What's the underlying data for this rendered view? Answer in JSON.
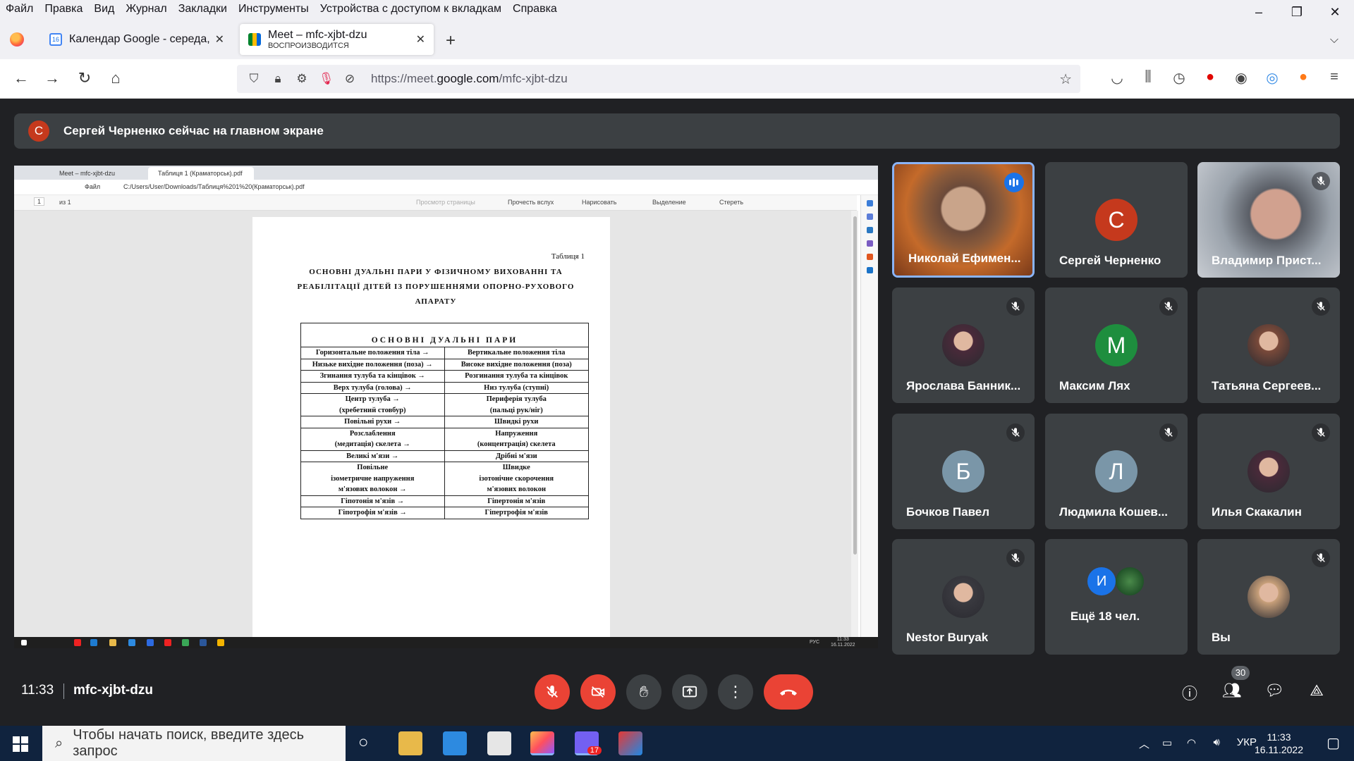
{
  "menubar": {
    "items": [
      "Файл",
      "Правка",
      "Вид",
      "Журнал",
      "Закладки",
      "Инструменты",
      "Устройства с доступом к вкладкам",
      "Справка"
    ]
  },
  "window_controls": {
    "minimize": "–",
    "restore": "❐",
    "close": "✕"
  },
  "tabs": [
    {
      "title": "Календар Google - середа, 16",
      "subtitle": "",
      "icon": "google-calendar-icon"
    },
    {
      "title": "Meet – mfc-xjbt-dzu",
      "subtitle": "ВОСПРОИЗВОДИТСЯ",
      "icon": "google-meet-icon"
    }
  ],
  "urlbar": {
    "url_prefix": "https://meet.",
    "url_domain": "google.com",
    "url_path": "/mfc-xjbt-dzu"
  },
  "banner": {
    "avatar_letter": "С",
    "text": "Сергей Черненко сейчас на главном экране"
  },
  "shared_screen": {
    "browser_tabs": [
      "Meet – mfc-xjbt-dzu",
      "Таблиця 1 (Краматорськ).pdf"
    ],
    "address": "C:/Users/User/Downloads/Таблиця%201%20(Краматорськ).pdf",
    "file_label": "Файл",
    "page_field": "1",
    "page_total": "из 1",
    "toolbar": [
      "Просмотр страницы",
      "Прочесть вслух",
      "Нарисовать",
      "Выделение",
      "Стереть"
    ],
    "document": {
      "table_number": "Таблиця 1",
      "title": "ОСНОВНІ ДУАЛЬНІ ПАРИ У ФІЗИЧНОМУ ВИХОВАННІ ТА РЕАБІЛІТАЦІЇ ДІТЕЙ ІЗ ПОРУШЕННЯМИ ОПОРНО-РУХОВОГО АПАРАТУ",
      "table_header": "ОСНОВНІ ДУАЛЬНІ ПАРИ",
      "rows": [
        [
          "Горизонтальне положення тіла →",
          "Вертикальне положення тіла"
        ],
        [
          "Низьке вихідне положення (поза) →",
          "Високе вихідне положення (поза)"
        ],
        [
          "Згинання тулуба та кінцівок →",
          "Розгинання тулуба та кінцівок"
        ],
        [
          "Верх тулуба (голова) →",
          "Низ тулуба (ступні)"
        ],
        [
          "Центр тулуба →\n(хребетний стовбур)",
          "Периферія тулуба\n(пальці рук/ніг)"
        ],
        [
          "Повільні рухи →",
          "Швидкі рухи"
        ],
        [
          "Розслаблення\n(медитація) скелета →",
          "Напруження\n(концентрація) скелета"
        ],
        [
          "Великі м'язи →",
          "Дрібні м'язи"
        ],
        [
          "Повільне\nізометричне напруження\nм'язових волокон →",
          "Швидке\nізотонічне скорочення\nм'язових волокон"
        ],
        [
          "Гіпотонія м'язів →",
          "Гіпертонія м'язів"
        ],
        [
          "Гіпотрофія м'язів →",
          "Гіпертрофія м'язів"
        ]
      ]
    },
    "taskbar_lang": "РУС",
    "taskbar_time": "11:33",
    "taskbar_date": "16.11.2022"
  },
  "participants": [
    {
      "name": "Николай Ефимен...",
      "type": "video",
      "speaking": true,
      "muted": false
    },
    {
      "name": "Сергей Черненко",
      "type": "letter",
      "letter": "С",
      "color": "#c5391d",
      "muted": false
    },
    {
      "name": "Владимир Прист...",
      "type": "video",
      "muted": true
    },
    {
      "name": "Ярослава Банник...",
      "type": "photo",
      "muted": true
    },
    {
      "name": "Максим Лях",
      "type": "letter",
      "letter": "М",
      "color": "#1e8e3e",
      "muted": true
    },
    {
      "name": "Татьяна Сергеев...",
      "type": "photo",
      "muted": true
    },
    {
      "name": "Бочков Павел",
      "type": "letter",
      "letter": "Б",
      "color": "#7a96a8",
      "muted": true
    },
    {
      "name": "Людмила Кошев...",
      "type": "letter",
      "letter": "Л",
      "color": "#7a96a8",
      "muted": true
    },
    {
      "name": "Илья Скакалин",
      "type": "photo",
      "muted": true
    },
    {
      "name": "Nestor Buryak",
      "type": "photo",
      "muted": true
    },
    {
      "name": "Ещё 18 чел.",
      "type": "more",
      "letter": "И",
      "color": "#1a73e8",
      "muted": false
    },
    {
      "name": "Вы",
      "type": "photo",
      "muted": true
    }
  ],
  "meet_bar": {
    "time": "11:33",
    "code": "mfc-xjbt-dzu",
    "participant_count": "30"
  },
  "windows_taskbar": {
    "search_placeholder": "Чтобы начать поиск, введите здесь запрос",
    "viber_badge": "17",
    "lang": "УКР",
    "time": "11:33",
    "date": "16.11.2022"
  },
  "colors": {
    "meet_bg": "#202124",
    "tile_bg": "#3c4043",
    "red": "#ea4335",
    "blue": "#1a73e8"
  }
}
